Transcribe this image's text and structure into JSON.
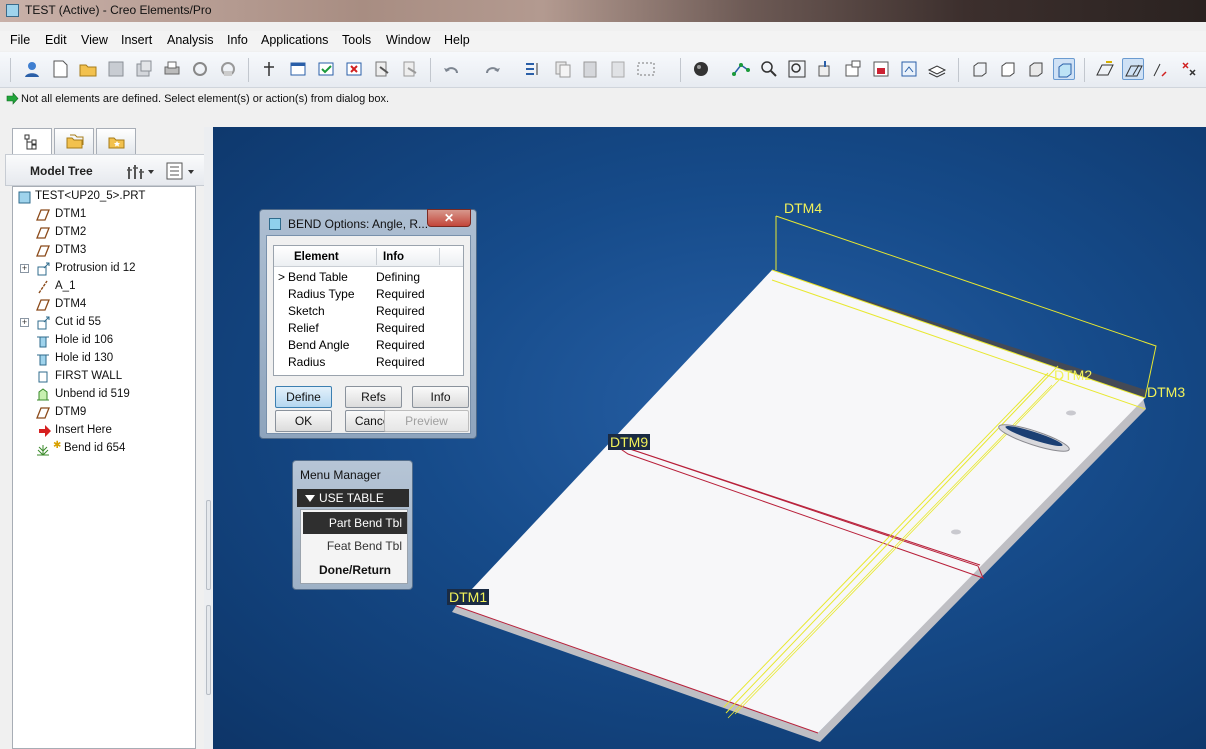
{
  "window": {
    "title": "TEST (Active) - Creo Elements/Pro"
  },
  "menu": [
    "File",
    "Edit",
    "View",
    "Insert",
    "Analysis",
    "Info",
    "Applications",
    "Tools",
    "Window",
    "Help"
  ],
  "toolbar": {
    "icons": [
      "user-icon",
      "new-file-icon",
      "open-folder-icon",
      "save-icon",
      "save-copy-icon",
      "print-icon",
      "send-icon",
      "mail-icon",
      "selection-icon",
      "window-icon",
      "close-window-icon",
      "erase-icon",
      "regenerate-icon",
      "copy-icon",
      "undo-icon",
      "redo-icon",
      "relations-icon",
      "copy-obj-icon",
      "paste-icon",
      "paste-special-icon",
      "select-box-icon",
      "shading-icon",
      "datum-icon",
      "zoom-in-icon",
      "zoom-fit-icon",
      "reorient-icon",
      "saved-views-icon",
      "layers-icon",
      "model-display-icon",
      "wireframe-icon",
      "hidden-line-icon",
      "no-hidden-icon",
      "shaded-icon",
      "plane-display-icon",
      "axis-display-icon",
      "point-display-icon",
      "csys-display-icon"
    ]
  },
  "status": {
    "message": "Not all elements are defined. Select element(s) or action(s) from dialog box."
  },
  "model_tree": {
    "title": "Model Tree",
    "items": [
      {
        "label": "TEST<UP20_5>.PRT",
        "icon": "part-icon",
        "expand": false
      },
      {
        "label": "DTM1",
        "icon": "datum-plane-icon",
        "expand": false
      },
      {
        "label": "DTM2",
        "icon": "datum-plane-icon",
        "expand": false
      },
      {
        "label": "DTM3",
        "icon": "datum-plane-icon",
        "expand": false
      },
      {
        "label": "Protrusion id 12",
        "icon": "protrusion-icon",
        "expand": true
      },
      {
        "label": "A_1",
        "icon": "datum-axis-icon",
        "expand": false
      },
      {
        "label": "DTM4",
        "icon": "datum-plane-icon",
        "expand": false
      },
      {
        "label": "Cut id 55",
        "icon": "cut-icon",
        "expand": true
      },
      {
        "label": "Hole id 106",
        "icon": "hole-icon",
        "expand": false
      },
      {
        "label": "Hole id 130",
        "icon": "hole-icon",
        "expand": false
      },
      {
        "label": "FIRST WALL",
        "icon": "wall-icon",
        "expand": false
      },
      {
        "label": "Unbend id 519",
        "icon": "unbend-icon",
        "expand": false
      },
      {
        "label": "DTM9",
        "icon": "datum-plane-icon",
        "expand": false
      },
      {
        "label": "Insert Here",
        "icon": "insert-arrow-icon",
        "expand": false
      },
      {
        "label": "Bend id 654",
        "icon": "bend-icon",
        "expand": false
      }
    ]
  },
  "viewport": {
    "datums": [
      "DTM4",
      "DTM2",
      "DTM3",
      "DTM9",
      "DTM1"
    ]
  },
  "bend_dialog": {
    "title": "BEND Options: Angle, R...",
    "close": "✕",
    "col_element": "Element",
    "col_info": "Info",
    "rows": [
      {
        "marker": ">",
        "element": "Bend Table",
        "info": "Defining"
      },
      {
        "marker": "",
        "element": "Radius Type",
        "info": "Required"
      },
      {
        "marker": "",
        "element": "Sketch",
        "info": "Required"
      },
      {
        "marker": "",
        "element": "Relief",
        "info": "Required"
      },
      {
        "marker": "",
        "element": "Bend Angle",
        "info": "Required"
      },
      {
        "marker": "",
        "element": "Radius",
        "info": "Required"
      }
    ],
    "buttons": {
      "define": "Define",
      "refs": "Refs",
      "info": "Info",
      "ok": "OK",
      "cancel": "Cancel",
      "preview": "Preview"
    }
  },
  "menu_manager": {
    "title": "Menu Manager",
    "section": "USE TABLE",
    "items": [
      "Part Bend Tbl",
      "Feat Bend Tbl",
      "Done/Return"
    ]
  }
}
